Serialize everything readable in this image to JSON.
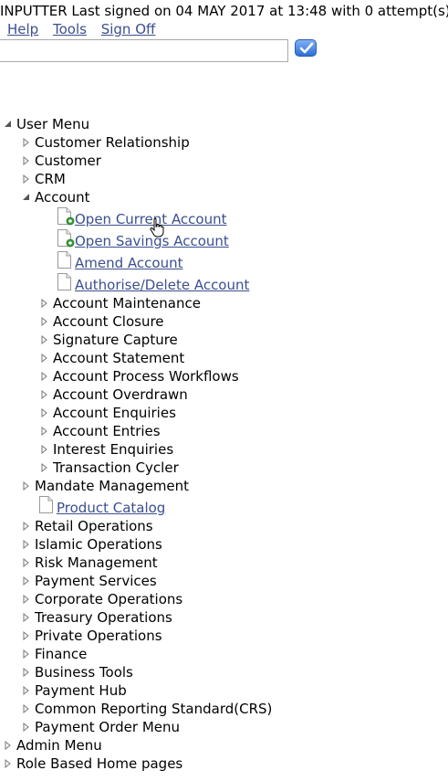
{
  "header": {
    "signon_text": "INPUTTER Last signed on 04 MAY 2017 at 13:48 with 0 attempt(s)",
    "links": [
      "Help",
      "Tools",
      "Sign Off"
    ],
    "command_input_value": "",
    "go_icon": "checkmark-icon"
  },
  "tree": {
    "user_menu": "User Menu",
    "customer_relationship": "Customer Relationship",
    "customer": "Customer",
    "crm": "CRM",
    "account": "Account",
    "open_current_account": "Open Current Account",
    "open_savings_account": "Open Savings Account",
    "amend_account": "Amend Account",
    "authorise_delete_account": "Authorise/Delete Account",
    "account_maintenance": "Account Maintenance",
    "account_closure": "Account Closure",
    "signature_capture": "Signature Capture",
    "account_statement": "Account Statement",
    "account_process_workflows": "Account Process Workflows",
    "account_overdrawn": "Account Overdrawn",
    "account_enquiries": "Account Enquiries",
    "account_entries": "Account Entries",
    "interest_enquiries": "Interest Enquiries",
    "transaction_cycler": "Transaction Cycler",
    "mandate_management": "Mandate Management",
    "product_catalog": "Product Catalog",
    "retail_operations": "Retail Operations",
    "islamic_operations": "Islamic Operations",
    "risk_management": "Risk Management",
    "payment_services": "Payment Services",
    "corporate_operations": "Corporate Operations",
    "treasury_operations": "Treasury Operations",
    "private_operations": "Private Operations",
    "finance": "Finance",
    "business_tools": "Business Tools",
    "payment_hub": "Payment Hub",
    "common_reporting_standard": "Common Reporting Standard(CRS)",
    "payment_order_menu": "Payment Order Menu",
    "admin_menu": "Admin Menu",
    "role_based_home_pages": "Role Based Home pages"
  },
  "colors": {
    "link": "#3b4f8f",
    "button": "#2f6fd6"
  }
}
